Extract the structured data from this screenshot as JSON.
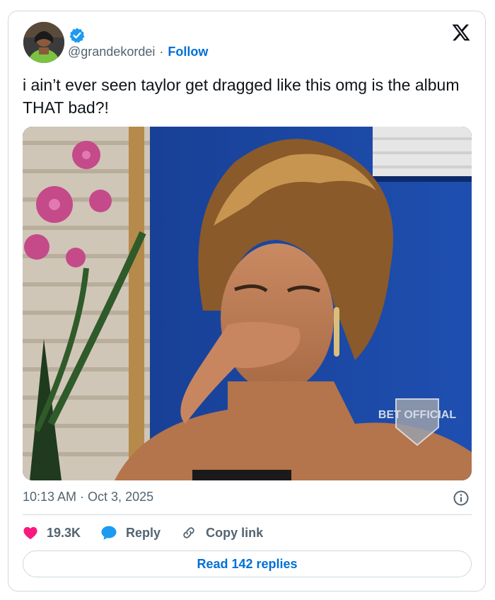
{
  "author": {
    "handle": "@grandekordei",
    "separator": "·",
    "follow_label": "Follow",
    "verified": true
  },
  "tweet": {
    "text": "i ain’t ever seen taylor get dragged like this omg is the album THAT bad?!",
    "timestamp": "10:13 AM · Oct 3, 2025"
  },
  "media": {
    "watermark": "BET OFFICIAL"
  },
  "actions": {
    "like_count": "19.3K",
    "reply_label": "Reply",
    "copy_link_label": "Copy link"
  },
  "read_replies_label": "Read 142 replies",
  "colors": {
    "link_blue": "#006fd6",
    "heart_pink": "#f91880",
    "verified_blue": "#1d9bf0",
    "secondary_text": "#536471",
    "border": "#cfd9de"
  },
  "icons": {
    "platform": "x-logo-icon",
    "verified": "verified-badge-icon",
    "info": "info-icon",
    "like": "heart-icon",
    "reply": "reply-bubble-icon",
    "copy_link": "link-icon"
  }
}
